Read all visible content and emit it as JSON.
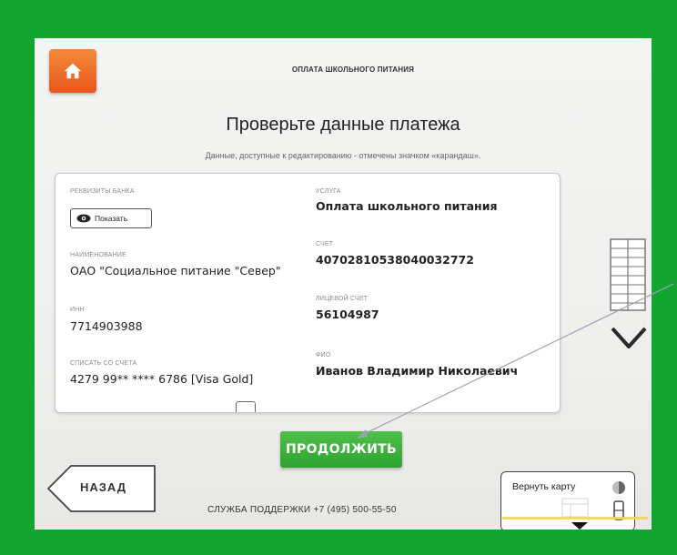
{
  "header": {
    "title": "ОПЛАТА ШКОЛЬНОГО ПИТАНИЯ"
  },
  "page": {
    "title": "Проверьте данные платежа",
    "subtitle": "Данные, доступные к редактированию - отмечены значком «карандаш»."
  },
  "details": {
    "bank": {
      "label": "РЕКВИЗИТЫ БАНКА",
      "button": "Показать"
    },
    "name": {
      "label": "НАИМЕНОВАНИЕ",
      "value": "ОАО \"Социальное питание \"Север\""
    },
    "inn": {
      "label": "ИНН",
      "value": "7714903988"
    },
    "debit": {
      "label": "СПИСАТЬ СО СЧЕТА",
      "value": "4279 99** **** 6786 [Visa Gold]"
    },
    "service": {
      "label": "УСЛУГА",
      "value": "Оплата школьного питания"
    },
    "account": {
      "label": "СЧЕТ",
      "value": "40702810538040032772"
    },
    "personal_account": {
      "label": "ЛИЦЕВОЙ СЧЕТ",
      "value": "56104987"
    },
    "fio": {
      "label": "ФИО",
      "value": "Иванов Владимир Николаевич"
    }
  },
  "actions": {
    "continue": "ПРОДОЛЖИТЬ",
    "back": "НАЗАД",
    "return_card": "Вернуть карту"
  },
  "footer": {
    "support": "СЛУЖБА ПОДДЕРЖКИ +7 (495) 500-55-50"
  },
  "colors": {
    "frame": "#14a531",
    "home_button": "#e8571b",
    "continue_button": "#2ea330"
  },
  "icons": [
    "home-icon",
    "eye-icon",
    "list-icon",
    "chevron-down-icon",
    "back-arrow-icon",
    "card-slot-icon",
    "disc-icon"
  ]
}
